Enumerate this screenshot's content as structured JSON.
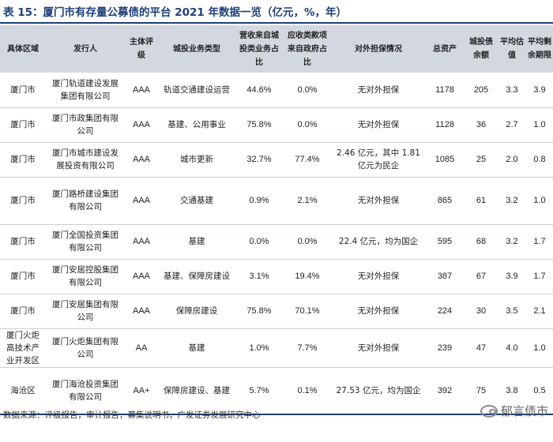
{
  "title": "表 15：厦门市有存量公募债的平台 2021 年数据一览（亿元，%，年）",
  "headers": [
    "具体区域",
    "发行人",
    "主体评级",
    "城投业务类型",
    "营收来自城投类业务占比",
    "应收类款项来自政府占比",
    "对外担保情况",
    "总资产",
    "城投债余额",
    "平均估值",
    "平均剩余期限"
  ],
  "rows": [
    [
      "厦门市",
      "厦门轨道建设发展集团有限公司",
      "AAA",
      "轨道交通建设运营",
      "44.6%",
      "0.0%",
      "无对外担保",
      "1178",
      "205",
      "3.3",
      "3.9"
    ],
    [
      "厦门市",
      "厦门市政集团有限公司",
      "AAA",
      "基建、公用事业",
      "75.8%",
      "0.0%",
      "无对外担保",
      "1128",
      "36",
      "2.7",
      "1.0"
    ],
    [
      "厦门市",
      "厦门市城市建设发展投资有限公司",
      "AAA",
      "城市更新",
      "32.7%",
      "77.4%",
      "2.46 亿元，其中 1.81 亿元为民企",
      "1085",
      "25",
      "2.0",
      "0.8"
    ],
    [
      "厦门市",
      "厦门路桥建设集团有限公司",
      "AAA",
      "交通基建",
      "0.9%",
      "2.1%",
      "无对外担保",
      "865",
      "61",
      "3.2",
      "1.0"
    ],
    [
      "厦门市",
      "厦门全国投资集团有限公司",
      "AAA",
      "基建",
      "0.0%",
      "0.0%",
      "22.4 亿元，均为国企",
      "595",
      "68",
      "3.2",
      "1.7"
    ],
    [
      "厦门市",
      "厦门安居控股集团有限公司",
      "AAA",
      "基建、保障房建设",
      "3.1%",
      "19.4%",
      "无对外担保",
      "387",
      "67",
      "3.9",
      "1.7"
    ],
    [
      "厦门市",
      "厦门安居集团有限公司",
      "AAA",
      "保障房建设",
      "75.8%",
      "70.1%",
      "无对外担保",
      "224",
      "30",
      "3.5",
      "2.1"
    ],
    [
      "厦门火炬高技术产业开发区",
      "厦门火炬集团有限公司",
      "AA",
      "基建",
      "1.0%",
      "7.7%",
      "无对外担保",
      "239",
      "47",
      "4.0",
      "1.0"
    ],
    [
      "海沧区",
      "厦门海沧投资集团有限公司",
      "AA+",
      "保障房建设、基建",
      "5.7%",
      "0.1%",
      "27.53 亿元，均为国企",
      "392",
      "75",
      "3.8",
      "0.5"
    ]
  ],
  "source": "数据来源：评级报告，审计报告，募集说明书，广发证券发展研究中心",
  "watermark": "郁言债市",
  "colors": {
    "header_bg": "#d3d8e0",
    "title": "#1f3f7a"
  }
}
